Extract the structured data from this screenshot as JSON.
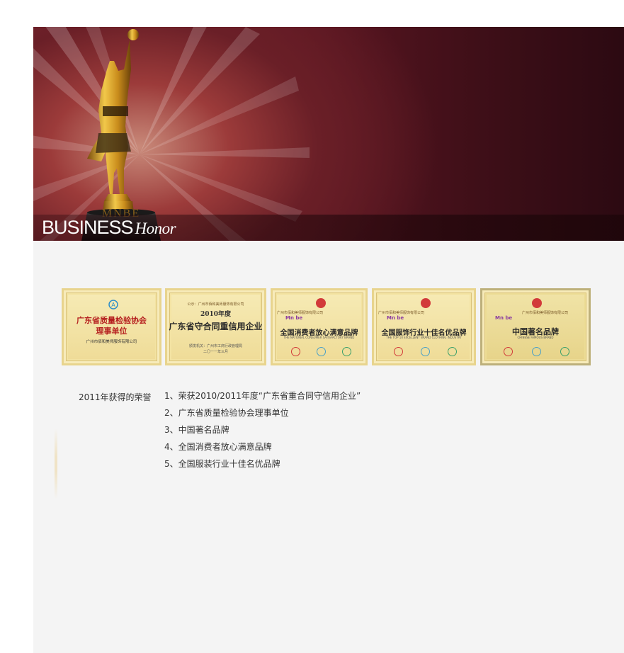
{
  "banner": {
    "title_bold": "BUSINESS",
    "title_italic": "Honor",
    "trophy_engraving": "MNBE"
  },
  "certificates": [
    {
      "title": "广东省质量检验协会理事单位",
      "line1": "广东省质量检验协会",
      "line2": "理事单位",
      "company": "广州市佰和美师服饰有限公司",
      "colors": {
        "bg": "#f3e3a2",
        "text": "#b51e1e"
      },
      "icon": "quality-association-emblem"
    },
    {
      "title": "2010年度广东省守合同重信用企业",
      "header": "公示：广州市佰和美师服饰有限公司",
      "year": "2010年度",
      "main": "广东省守合同重信用企业",
      "footer": "颁发机关：广州市工商行政管理局",
      "date": "二〇一一年三月",
      "colors": {
        "bg": "#f3e3a2",
        "text": "#b51e1e"
      }
    },
    {
      "title": "全国消费者放心满意品牌",
      "header": "广州市佰和美师服饰有限公司",
      "brand": "Mn be",
      "main": "全国消费者放心满意品牌",
      "english": "THE NATIONAL CONSUMER SATISFACTORY BRAND",
      "colors": {
        "bg": "#f3e3a2",
        "text": "#b51e1e"
      }
    },
    {
      "title": "全国服饰行业十佳名优品牌",
      "header": "广州市佰和美师服饰有限公司",
      "brand": "Mn be",
      "main": "全国服饰行业十佳名优品牌",
      "english": "THE TOP 10 EXCELLENT BRAND CLOTHING INDUSTRY",
      "colors": {
        "bg": "#f3e3a2",
        "text": "#b51e1e"
      }
    },
    {
      "title": "中国著名品牌",
      "header": "广州市佰和美师服饰有限公司",
      "brand": "Mn be",
      "main": "中国著名品牌",
      "english": "CHINESE FAMOUS BRAND",
      "colors": {
        "bg": "#ecdc95",
        "text": "#b51e1e"
      }
    }
  ],
  "honors": {
    "label": "2011年获得的荣誉",
    "items": [
      "1、荣获2010/2011年度“广东省重合同守信用企业”",
      "2、广东省质量检验协会理事单位",
      "3、中国著名品牌",
      "4、全国消费者放心满意品牌",
      "5、全国服装行业十佳名优品牌"
    ]
  }
}
